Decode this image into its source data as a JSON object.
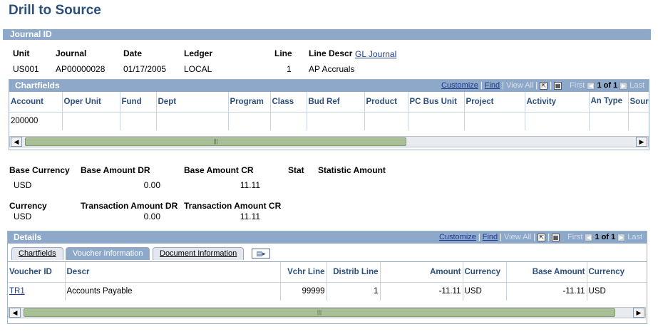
{
  "page": {
    "title": "Drill to Source"
  },
  "journal": {
    "section_label": "Journal ID",
    "labels": {
      "unit": "Unit",
      "journal": "Journal",
      "date": "Date",
      "ledger": "Ledger",
      "line": "Line",
      "line_descr": "Line Descr"
    },
    "values": {
      "unit": "US001",
      "journal": "AP00000028",
      "date": "01/17/2005",
      "ledger": "LOCAL",
      "line": "1",
      "line_descr": "AP Accruals",
      "line_descr_link": "GL Journal"
    }
  },
  "chartfields": {
    "title": "Chartfields",
    "toolbar": {
      "customize": "Customize",
      "find": "Find",
      "view_all": "View All",
      "first": "First",
      "count": "1 of 1",
      "last": "Last"
    },
    "columns": [
      "Account",
      "Oper Unit",
      "Fund",
      "Dept",
      "Program",
      "Class",
      "Bud Ref",
      "Product",
      "PC Bus Unit",
      "Project",
      "Activity",
      "An Type",
      "Source"
    ],
    "rows": [
      [
        "200000",
        "",
        "",
        "",
        "",
        "",
        "",
        "",
        "",
        "",
        "",
        "",
        ""
      ]
    ]
  },
  "amounts": {
    "labels": {
      "base_currency": "Base Currency",
      "base_amount_dr": "Base Amount DR",
      "base_amount_cr": "Base Amount CR",
      "stat": "Stat",
      "statistic_amount": "Statistic Amount",
      "currency": "Currency",
      "transaction_amount_dr": "Transaction Amount DR",
      "transaction_amount_cr": "Transaction Amount CR"
    },
    "values": {
      "base_currency": "USD",
      "base_amount_dr": "0.00",
      "base_amount_cr": "11.11",
      "currency": "USD",
      "transaction_amount_dr": "0.00",
      "transaction_amount_cr": "11.11"
    }
  },
  "details": {
    "title": "Details",
    "toolbar": {
      "customize": "Customize",
      "find": "Find",
      "view_all": "View All",
      "first": "First",
      "count": "1 of 1",
      "last": "Last"
    },
    "tabs": [
      "Chartfields",
      "Voucher Information",
      "Document Information"
    ],
    "columns": [
      "Voucher ID",
      "Descr",
      "Vchr Line",
      "Distrib Line",
      "Amount",
      "Currency",
      "Base Amount",
      "Currency"
    ],
    "rows": [
      [
        "TR1",
        "Accounts Payable",
        "99999",
        "1",
        "-11.11",
        "USD",
        "-11.11",
        "USD"
      ]
    ]
  }
}
